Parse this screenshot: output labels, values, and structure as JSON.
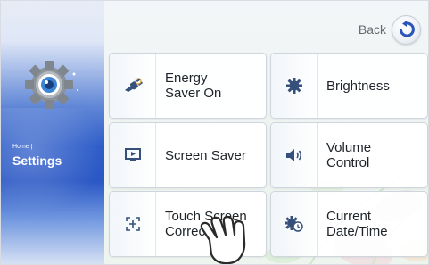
{
  "sidebar": {
    "breadcrumb": "Home |",
    "title": "Settings",
    "icon": "settings-gear-eye-icon"
  },
  "header": {
    "back_label": "Back",
    "back_icon": "back-arrow-icon"
  },
  "tiles": [
    {
      "label": "Energy\nSaver On",
      "icon": "energy-plug-icon"
    },
    {
      "label": "Brightness",
      "icon": "brightness-gear-icon"
    },
    {
      "label": "Screen Saver",
      "icon": "monitor-play-icon"
    },
    {
      "label": "Volume\nControl",
      "icon": "speaker-icon"
    },
    {
      "label": "Touch Screen\nCorrection",
      "icon": "touch-target-icon"
    },
    {
      "label": "Current\nDate/Time",
      "icon": "gear-clock-icon"
    }
  ],
  "colors": {
    "accent_blue": "#2d5cc8",
    "icon_color": "#35507a"
  }
}
